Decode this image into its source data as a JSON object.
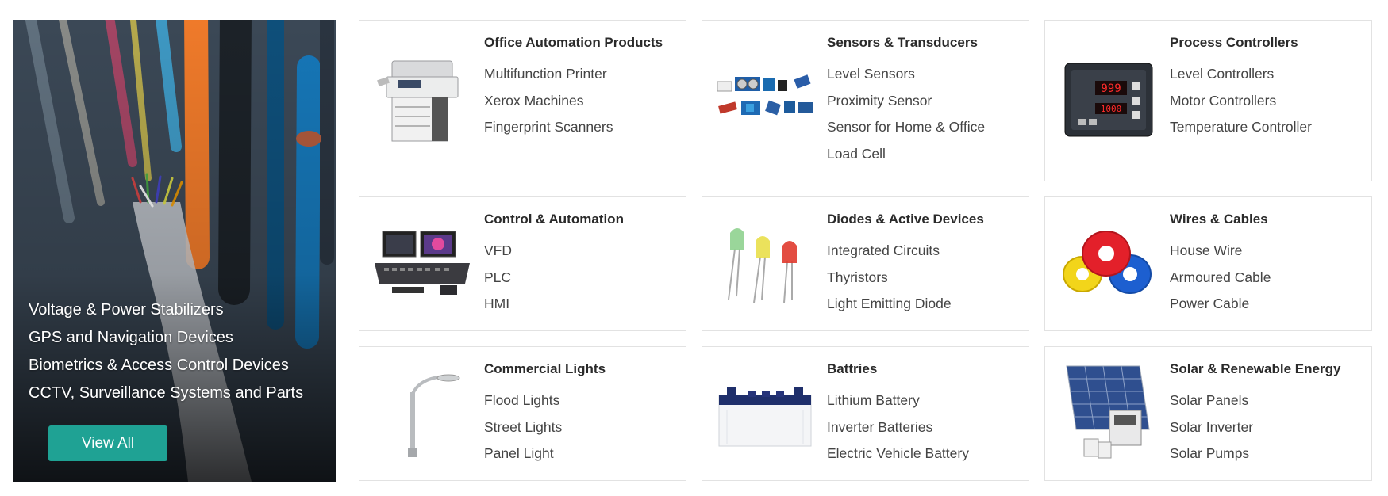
{
  "hero": {
    "links": [
      "Voltage & Power Stabilizers",
      "GPS and Navigation Devices",
      "Biometrics & Access Control Devices",
      "CCTV, Surveillance Systems and Parts"
    ],
    "button_label": "View All"
  },
  "categories": [
    {
      "title": "Office Automation Products",
      "icon": "printer-icon",
      "items": [
        "Multifunction Printer",
        "Xerox Machines",
        "Fingerprint Scanners"
      ]
    },
    {
      "title": "Sensors & Transducers",
      "icon": "sensor-modules-icon",
      "items": [
        "Level Sensors",
        "Proximity Sensor",
        "Sensor for Home & Office",
        "Load Cell"
      ]
    },
    {
      "title": "Process Controllers",
      "icon": "controller-unit-icon",
      "items": [
        "Level Controllers",
        "Motor Controllers",
        "Temperature Controller"
      ]
    },
    {
      "title": "Control & Automation",
      "icon": "control-console-icon",
      "items": [
        "VFD",
        "PLC",
        "HMI"
      ]
    },
    {
      "title": "Diodes & Active Devices",
      "icon": "led-diodes-icon",
      "items": [
        "Integrated Circuits",
        "Thyristors",
        "Light Emitting Diode"
      ]
    },
    {
      "title": "Wires & Cables",
      "icon": "cable-coils-icon",
      "items": [
        "House Wire",
        "Armoured Cable",
        "Power Cable"
      ]
    },
    {
      "title": "Commercial Lights",
      "icon": "street-light-icon",
      "items": [
        "Flood Lights",
        "Street Lights",
        "Panel Light"
      ]
    },
    {
      "title": "Battries",
      "icon": "battery-icon",
      "items": [
        "Lithium Battery",
        "Inverter Batteries",
        "Electric Vehicle Battery"
      ]
    },
    {
      "title": "Solar & Renewable Energy",
      "icon": "solar-panel-icon",
      "items": [
        "Solar Panels",
        "Solar Inverter",
        "Solar Pumps"
      ]
    }
  ],
  "colors": {
    "button": "#1fa294",
    "card_border": "#e2e2e2",
    "led_green": "#8fd18f",
    "led_yellow": "#e9df4a",
    "led_red": "#e03a2e"
  }
}
